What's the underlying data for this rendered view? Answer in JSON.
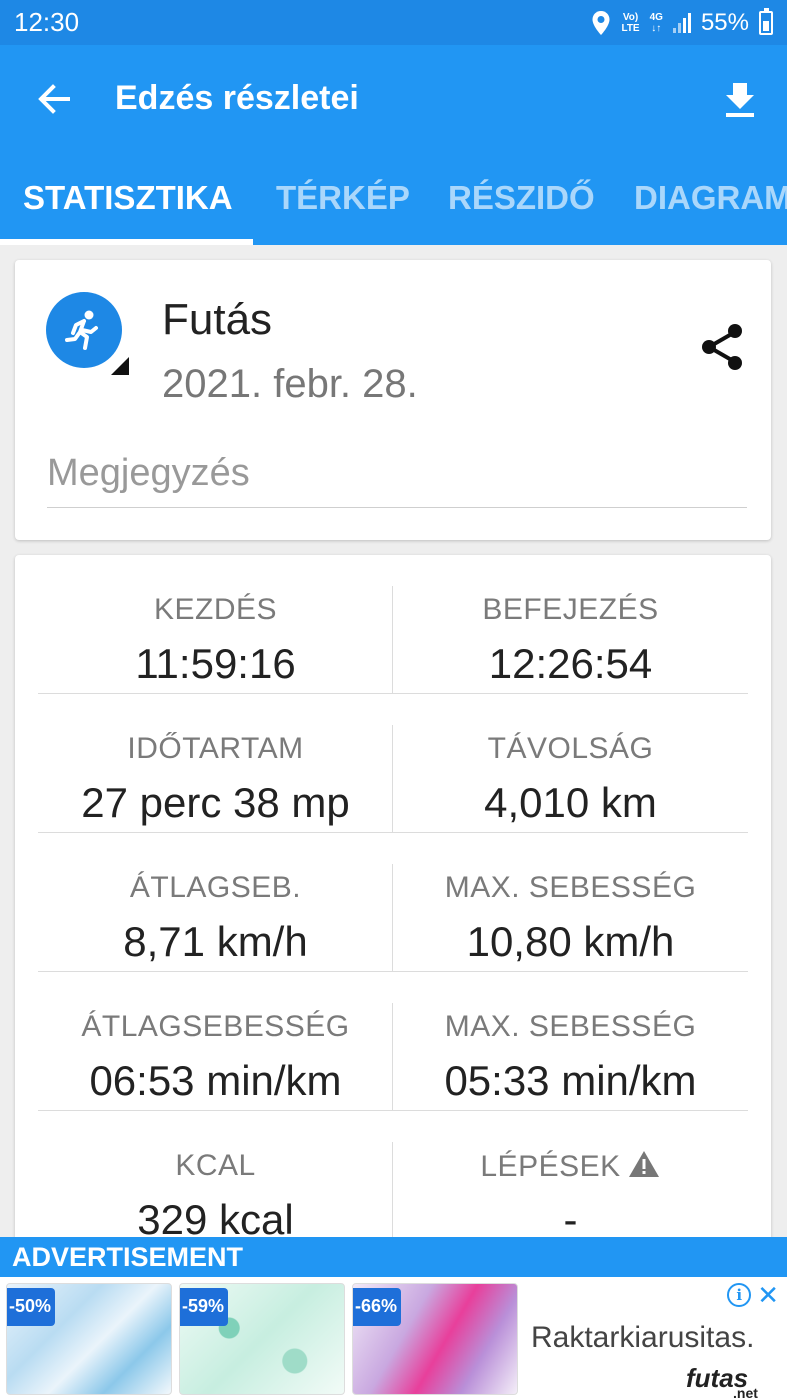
{
  "status_bar": {
    "time": "12:30",
    "network_top": "Vo)",
    "network_bottom": "LTE",
    "data_top": "4G",
    "data_bottom": "↓↑",
    "battery": "55%"
  },
  "app_bar": {
    "title": "Edzés részletei"
  },
  "tabs": [
    {
      "label": "STATISZTIKA",
      "active": true
    },
    {
      "label": "TÉRKÉP",
      "active": false
    },
    {
      "label": "RÉSZIDŐ",
      "active": false
    },
    {
      "label": "DIAGRAM",
      "active": false
    }
  ],
  "activity": {
    "name": "Futás",
    "date": "2021. febr. 28.",
    "note_placeholder": "Megjegyzés",
    "icon_color": "#1e88e5"
  },
  "stats": [
    {
      "left": {
        "label": "KEZDÉS",
        "value": "11:59:16"
      },
      "right": {
        "label": "BEFEJEZÉS",
        "value": "12:26:54"
      }
    },
    {
      "left": {
        "label": "IDŐTARTAM",
        "value": "27 perc 38 mp"
      },
      "right": {
        "label": "TÁVOLSÁG",
        "value": "4,010 km"
      }
    },
    {
      "left": {
        "label": "ÁTLAGSEB.",
        "value": "8,71 km/h"
      },
      "right": {
        "label": "MAX. SEBESSÉG",
        "value": "10,80 km/h"
      }
    },
    {
      "left": {
        "label": "ÁTLAGSEBESSÉG",
        "value": "06:53 min/km"
      },
      "right": {
        "label": "MAX. SEBESSÉG",
        "value": "05:33 min/km"
      }
    },
    {
      "left": {
        "label": "KCAL",
        "value": "329 kcal"
      },
      "right": {
        "label": "LÉPÉSEK",
        "value": "-"
      }
    }
  ],
  "ad": {
    "header": "ADVERTISEMENT",
    "badges": [
      "-50%",
      "-59%",
      "-66%"
    ],
    "brand": "Raktarkiarusitas.",
    "logo": "futas",
    "logo_suffix": ".net"
  },
  "colors": {
    "primary": "#2196f3",
    "status_bar": "#1e88e5"
  }
}
